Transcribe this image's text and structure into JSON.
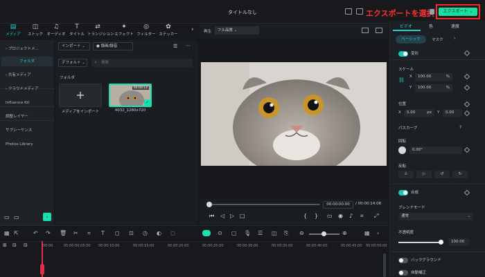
{
  "window": {
    "title": "タイトルなし"
  },
  "annotation": "エクスポートを選択",
  "export_button": "エクスポート",
  "toolbar": [
    {
      "label": "メディア",
      "icon": "media-icon"
    },
    {
      "label": "ストック",
      "icon": "stock-icon"
    },
    {
      "label": "オーディオ",
      "icon": "audio-icon"
    },
    {
      "label": "タイトル",
      "icon": "title-icon"
    },
    {
      "label": "トランジション",
      "icon": "transition-icon"
    },
    {
      "label": "エフェクト",
      "icon": "effect-icon"
    },
    {
      "label": "フィルター",
      "icon": "filter-icon"
    },
    {
      "label": "ステッカー",
      "icon": "sticker-icon"
    }
  ],
  "sidebar": {
    "items": [
      "プロジェクトメ...",
      "フォルダ",
      "共有メディア",
      "クラウドメディア",
      "Influence Kit",
      "調整レイヤー",
      "サブシーケンス",
      "Photos Library"
    ]
  },
  "media": {
    "import_label": "インポート",
    "record_label": "録画/録音",
    "default_label": "デフォルト",
    "search_placeholder": "検索",
    "folder_label": "フォルダ",
    "import_tile_label": "メディアをインポート",
    "clip_name": "4032_1280x720",
    "clip_duration": "00:00:14"
  },
  "player": {
    "label": "再生",
    "quality": "フル品質",
    "time_current": "00:00:00:00",
    "time_total": "/ 00:00:14:08"
  },
  "properties": {
    "tabs": [
      "ビデオ",
      "色",
      "速度"
    ],
    "subtabs": [
      "ベーシック",
      "マスク"
    ],
    "transform_label": "変形",
    "scale_label": "スケール",
    "scale_x": "100.00",
    "scale_y": "100.00",
    "scale_unit": "%",
    "position_label": "位置",
    "pos_x": "0.00",
    "pos_y": "0.00",
    "pos_unit": "px",
    "path_curve": "パスカーブ",
    "rotate_label": "回転",
    "rotate_value": "0.00°",
    "flip_label": "反転",
    "composite_label": "合成",
    "blend_label": "ブレンドモード",
    "blend_value": "通常",
    "opacity_label": "不透明度",
    "opacity_value": "100.00",
    "background_label": "バックグラウンド",
    "auto_correct_label": "自動補正"
  },
  "timeline": {
    "ticks": [
      "00:00",
      "00:00:00:05:00",
      "00:00:10:00",
      "00:00:15:00",
      "00:00:20:00",
      "00:00:25:00",
      "00:00:30:00",
      "00:00:35:00",
      "00:00:40:00",
      "00:00:45:00",
      "00:00:50:00"
    ]
  },
  "colors": {
    "accent": "#19e0b0",
    "annotation": "#ff2828",
    "playhead": "#e0304a"
  }
}
